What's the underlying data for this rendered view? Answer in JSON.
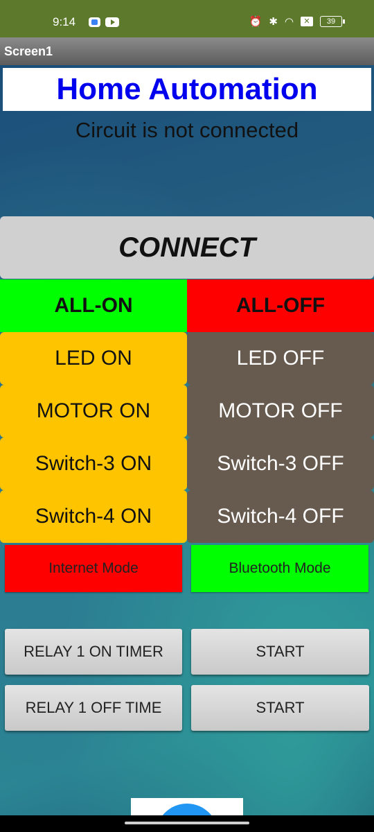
{
  "status_bar": {
    "time": "9:14",
    "battery": "39",
    "notification_x": "✕",
    "icons": [
      "alarm-icon",
      "bluetooth-icon",
      "wifi-icon"
    ]
  },
  "window": {
    "title": "Screen1"
  },
  "app": {
    "heading": "Home Automation",
    "status_text": "Circuit is not connected",
    "connect_label": "CONNECT",
    "all_on_label": "ALL-ON",
    "all_off_label": "ALL-OFF",
    "controls": [
      {
        "on": "LED ON",
        "off": "LED OFF"
      },
      {
        "on": "MOTOR ON",
        "off": "MOTOR OFF"
      },
      {
        "on": "Switch-3 ON",
        "off": "Switch-3 OFF"
      },
      {
        "on": "Switch-4 ON",
        "off": "Switch-4 OFF"
      }
    ],
    "modes": {
      "internet": "Internet Mode",
      "bluetooth": "Bluetooth Mode"
    },
    "timers": [
      {
        "label": "RELAY 1 ON TIMER",
        "action": "START"
      },
      {
        "label": "RELAY 1 OFF TIME",
        "action": "START"
      }
    ]
  },
  "colors": {
    "heading_text": "#0000ee",
    "all_on": "#00ff00",
    "all_off": "#ff0000",
    "on_button": "#ffc400",
    "off_button": "#675a4f",
    "status_bar": "#5d7a2c"
  }
}
